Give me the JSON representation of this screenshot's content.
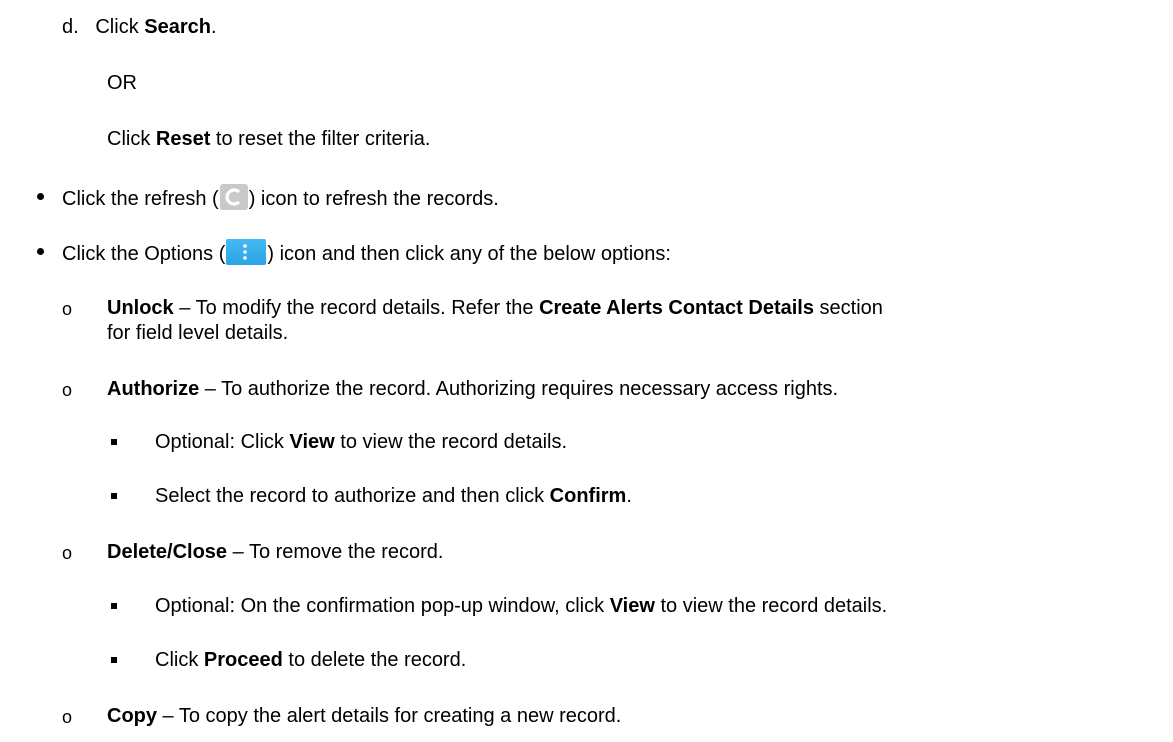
{
  "step_d": {
    "marker": "d.",
    "prefix": "Click ",
    "bold": "Search",
    "suffix": "."
  },
  "or_text": "OR",
  "reset_line": {
    "prefix": "Click ",
    "bold": "Reset",
    "suffix": " to reset the filter criteria."
  },
  "refresh_line": {
    "prefix": "Click the refresh (",
    "icon": "refresh-icon",
    "suffix": ") icon to refresh the records."
  },
  "options_line": {
    "prefix": "Click the Options (",
    "icon": "options-icon",
    "suffix": ") icon and then click any of the below options:"
  },
  "options": [
    {
      "bold": "Unlock",
      "text1": " – To modify the record details. Refer the ",
      "bold2": "Create Alerts Contact Details",
      "text2": " section",
      "text3": "for field level details."
    },
    {
      "bold": "Authorize",
      "text1": " – To authorize the record. Authorizing requires necessary access rights.",
      "sub": [
        {
          "prefix": "Optional: Click ",
          "bold": "View",
          "suffix": " to view the record details."
        },
        {
          "prefix": "Select the record to authorize and then click ",
          "bold": "Confirm",
          "suffix": "."
        }
      ]
    },
    {
      "bold": "Delete/Close",
      "text1": " – To remove the record.",
      "sub": [
        {
          "prefix": "Optional: On the confirmation pop-up window, click ",
          "bold": "View",
          "suffix": " to view the record details."
        },
        {
          "prefix": "Click ",
          "bold": "Proceed",
          "suffix": " to delete the record."
        }
      ]
    },
    {
      "bold": "Copy",
      "text1": " – To copy the alert details for creating a new record."
    }
  ],
  "bullet_marker_o": "o"
}
